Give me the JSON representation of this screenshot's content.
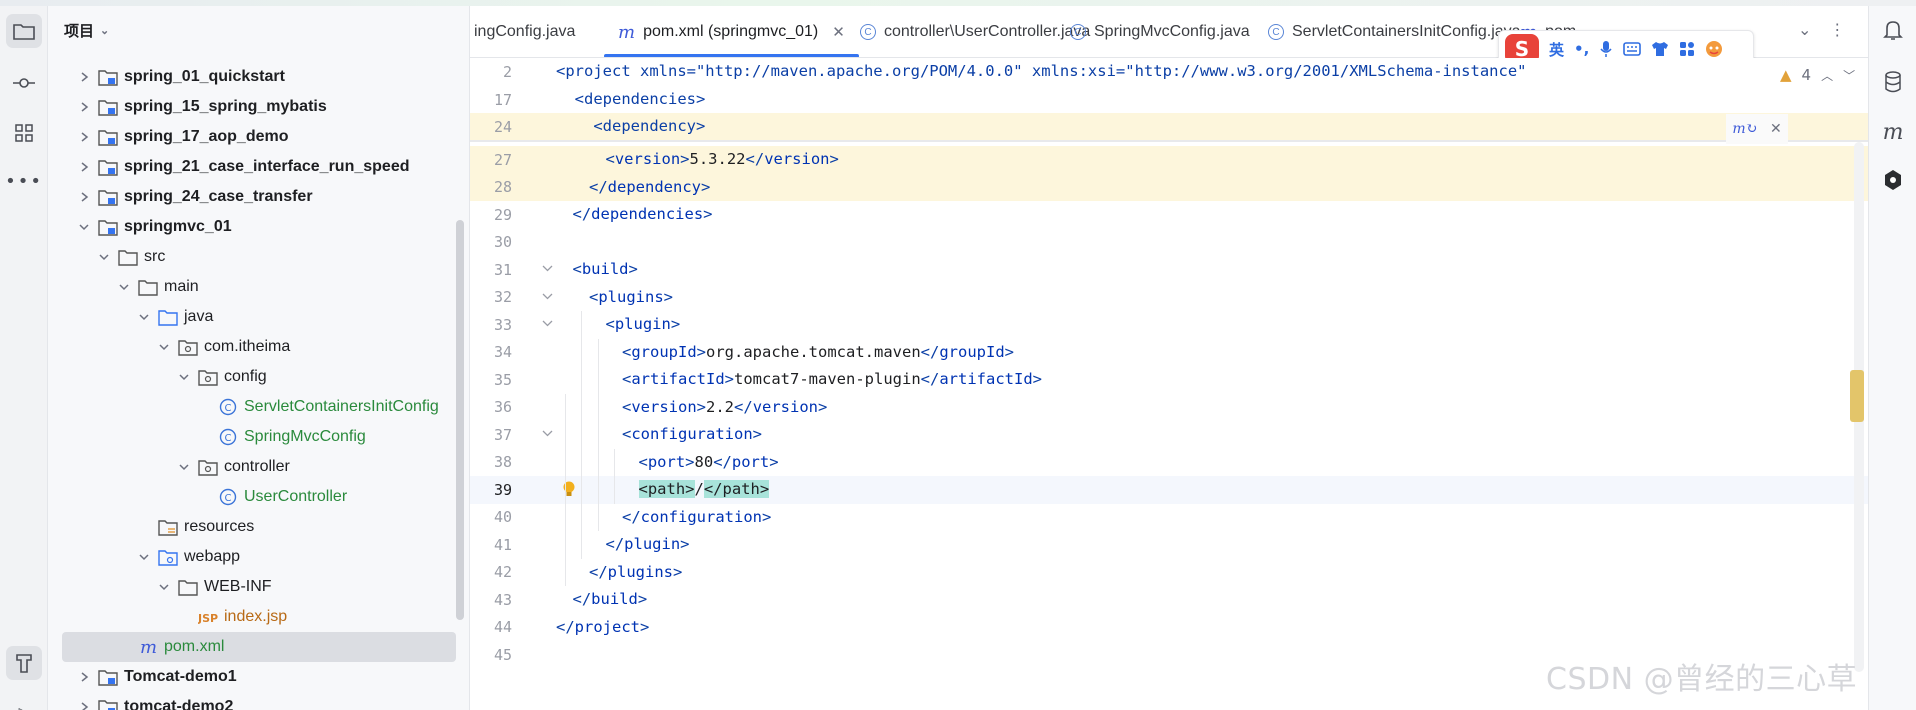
{
  "project_panel": {
    "title": "项目",
    "tree": [
      {
        "label": "spring_01_quickstart",
        "depth": 0,
        "arrow": "right",
        "icon": "module-folder",
        "style": "bold"
      },
      {
        "label": "spring_15_spring_mybatis",
        "depth": 0,
        "arrow": "right",
        "icon": "module-folder",
        "style": "bold"
      },
      {
        "label": "spring_17_aop_demo",
        "depth": 0,
        "arrow": "right",
        "icon": "module-folder",
        "style": "bold"
      },
      {
        "label": "spring_21_case_interface_run_speed",
        "depth": 0,
        "arrow": "right",
        "icon": "module-folder",
        "style": "bold"
      },
      {
        "label": "spring_24_case_transfer",
        "depth": 0,
        "arrow": "right",
        "icon": "module-folder",
        "style": "bold"
      },
      {
        "label": "springmvc_01",
        "depth": 0,
        "arrow": "down",
        "icon": "module-folder",
        "style": "bold"
      },
      {
        "label": "src",
        "depth": 1,
        "arrow": "down",
        "icon": "folder",
        "style": "normal"
      },
      {
        "label": "main",
        "depth": 2,
        "arrow": "down",
        "icon": "folder",
        "style": "normal"
      },
      {
        "label": "java",
        "depth": 3,
        "arrow": "down",
        "icon": "source-folder",
        "style": "normal"
      },
      {
        "label": "com.itheima",
        "depth": 4,
        "arrow": "down",
        "icon": "package",
        "style": "normal"
      },
      {
        "label": "config",
        "depth": 5,
        "arrow": "down",
        "icon": "package",
        "style": "normal"
      },
      {
        "label": "ServletContainersInitConfig",
        "depth": 6,
        "arrow": "none",
        "icon": "class",
        "style": "green"
      },
      {
        "label": "SpringMvcConfig",
        "depth": 6,
        "arrow": "none",
        "icon": "class",
        "style": "green"
      },
      {
        "label": "controller",
        "depth": 5,
        "arrow": "down",
        "icon": "package",
        "style": "normal"
      },
      {
        "label": "UserController",
        "depth": 6,
        "arrow": "none",
        "icon": "class",
        "style": "green"
      },
      {
        "label": "resources",
        "depth": 3,
        "arrow": "none",
        "icon": "resources-folder",
        "style": "normal"
      },
      {
        "label": "webapp",
        "depth": 3,
        "arrow": "down",
        "icon": "web-folder",
        "style": "normal"
      },
      {
        "label": "WEB-INF",
        "depth": 4,
        "arrow": "down",
        "icon": "folder",
        "style": "normal"
      },
      {
        "label": "index.jsp",
        "depth": 5,
        "arrow": "none",
        "icon": "jsp",
        "style": "orange"
      },
      {
        "label": "pom.xml",
        "depth": 2,
        "arrow": "none",
        "icon": "maven",
        "style": "green",
        "selected": true
      },
      {
        "label": "Tomcat-demo1",
        "depth": 0,
        "arrow": "right",
        "icon": "module-folder",
        "style": "bold"
      },
      {
        "label": "tomcat-demo2",
        "depth": 0,
        "arrow": "right",
        "icon": "module-folder",
        "style": "bold"
      }
    ]
  },
  "tabs": [
    {
      "label": "ingConfig.java",
      "icon": "none",
      "active": false
    },
    {
      "label": "pom.xml (springmvc_01)",
      "icon": "maven",
      "active": true
    },
    {
      "label": "controller\\UserController.java",
      "icon": "class",
      "active": false
    },
    {
      "label": "SpringMvcConfig.java",
      "icon": "class",
      "active": false
    },
    {
      "label": "ServletContainersInitConfig.java",
      "icon": "class",
      "active": false
    },
    {
      "label": "pom",
      "icon": "maven",
      "active": false
    }
  ],
  "ime_toolbar": {
    "logo": "S",
    "lang": "英",
    "punct": "•,"
  },
  "editor": {
    "warning_count": "4",
    "sticky_lines": [
      {
        "num": "2",
        "text": "<project xmlns=\"http://maven.apache.org/POM/4.0.0\" xmlns:xsi=\"http://www.w3.org/2001/XMLSchema-instance\""
      },
      {
        "num": "17",
        "text": "  <dependencies>"
      },
      {
        "num": "24",
        "text": "    <dependency>"
      }
    ],
    "lines": [
      {
        "num": "27",
        "indent": 3,
        "parts": [
          [
            "tg",
            "<"
          ],
          [
            "tgn",
            "version"
          ],
          [
            "tg",
            ">"
          ],
          [
            "t",
            "5.3.22"
          ],
          [
            "tg",
            "</"
          ],
          [
            "tgn",
            "version"
          ],
          [
            "tg",
            ">"
          ]
        ],
        "hl": true
      },
      {
        "num": "28",
        "indent": 2,
        "parts": [
          [
            "tg",
            "</"
          ],
          [
            "tgn",
            "dependency"
          ],
          [
            "tg",
            ">"
          ]
        ],
        "hl": true
      },
      {
        "num": "29",
        "indent": 1,
        "parts": [
          [
            "tg",
            "</"
          ],
          [
            "tgn",
            "dependencies"
          ],
          [
            "tg",
            ">"
          ]
        ]
      },
      {
        "num": "30",
        "indent": 0,
        "parts": []
      },
      {
        "num": "31",
        "indent": 1,
        "fold": true,
        "parts": [
          [
            "tg",
            "<"
          ],
          [
            "tgn",
            "build"
          ],
          [
            "tg",
            ">"
          ]
        ]
      },
      {
        "num": "32",
        "indent": 2,
        "fold": true,
        "parts": [
          [
            "tg",
            "<"
          ],
          [
            "tgn",
            "plugins"
          ],
          [
            "tg",
            ">"
          ]
        ]
      },
      {
        "num": "33",
        "indent": 3,
        "fold": true,
        "parts": [
          [
            "tg",
            "<"
          ],
          [
            "tgn",
            "plugin"
          ],
          [
            "tg",
            ">"
          ]
        ]
      },
      {
        "num": "34",
        "indent": 4,
        "parts": [
          [
            "tg",
            "<"
          ],
          [
            "tgn",
            "groupId"
          ],
          [
            "tg",
            ">"
          ],
          [
            "t",
            "org.apache.tomcat.maven"
          ],
          [
            "tg",
            "</"
          ],
          [
            "tgn",
            "groupId"
          ],
          [
            "tg",
            ">"
          ]
        ]
      },
      {
        "num": "35",
        "indent": 4,
        "parts": [
          [
            "tg",
            "<"
          ],
          [
            "tgn",
            "artifactId"
          ],
          [
            "tg",
            ">"
          ],
          [
            "t",
            "tomcat7-maven-plugin"
          ],
          [
            "tg",
            "</"
          ],
          [
            "tgn",
            "artifactId"
          ],
          [
            "tg",
            ">"
          ]
        ]
      },
      {
        "num": "36",
        "indent": 4,
        "parts": [
          [
            "tg",
            "<"
          ],
          [
            "tgn",
            "version"
          ],
          [
            "tg",
            ">"
          ],
          [
            "t",
            "2.2"
          ],
          [
            "tg",
            "</"
          ],
          [
            "tgn",
            "version"
          ],
          [
            "tg",
            ">"
          ]
        ]
      },
      {
        "num": "37",
        "indent": 4,
        "fold": true,
        "parts": [
          [
            "tg",
            "<"
          ],
          [
            "tgn",
            "configuration"
          ],
          [
            "tg",
            ">"
          ]
        ]
      },
      {
        "num": "38",
        "indent": 5,
        "parts": [
          [
            "tg",
            "<"
          ],
          [
            "tgn",
            "port"
          ],
          [
            "tg",
            ">"
          ],
          [
            "t",
            "80"
          ],
          [
            "tg",
            "</"
          ],
          [
            "tgn",
            "port"
          ],
          [
            "tg",
            ">"
          ]
        ]
      },
      {
        "num": "39",
        "indent": 5,
        "caret": true,
        "bulb": true,
        "parts": [
          [
            "hl",
            "<path>"
          ],
          [
            "t",
            "/"
          ],
          [
            "hl",
            "</path>"
          ]
        ]
      },
      {
        "num": "40",
        "indent": 4,
        "parts": [
          [
            "tg",
            "</"
          ],
          [
            "tgn",
            "configuration"
          ],
          [
            "tg",
            ">"
          ]
        ]
      },
      {
        "num": "41",
        "indent": 3,
        "parts": [
          [
            "tg",
            "</"
          ],
          [
            "tgn",
            "plugin"
          ],
          [
            "tg",
            ">"
          ]
        ]
      },
      {
        "num": "42",
        "indent": 2,
        "parts": [
          [
            "tg",
            "</"
          ],
          [
            "tgn",
            "plugins"
          ],
          [
            "tg",
            ">"
          ]
        ]
      },
      {
        "num": "43",
        "indent": 1,
        "parts": [
          [
            "tg",
            "</"
          ],
          [
            "tgn",
            "build"
          ],
          [
            "tg",
            ">"
          ]
        ]
      },
      {
        "num": "44",
        "indent": 0,
        "parts": [
          [
            "tg",
            "</"
          ],
          [
            "tgn",
            "project"
          ],
          [
            "tg",
            ">"
          ]
        ]
      },
      {
        "num": "45",
        "indent": 0,
        "parts": []
      }
    ]
  },
  "watermark": "CSDN @曾经的三心草",
  "colors": {
    "accent": "#3574f0",
    "tag": "#0033b3",
    "string": "#067d17",
    "highlight_line": "#fdf6dc",
    "match": "#a8e3da"
  }
}
